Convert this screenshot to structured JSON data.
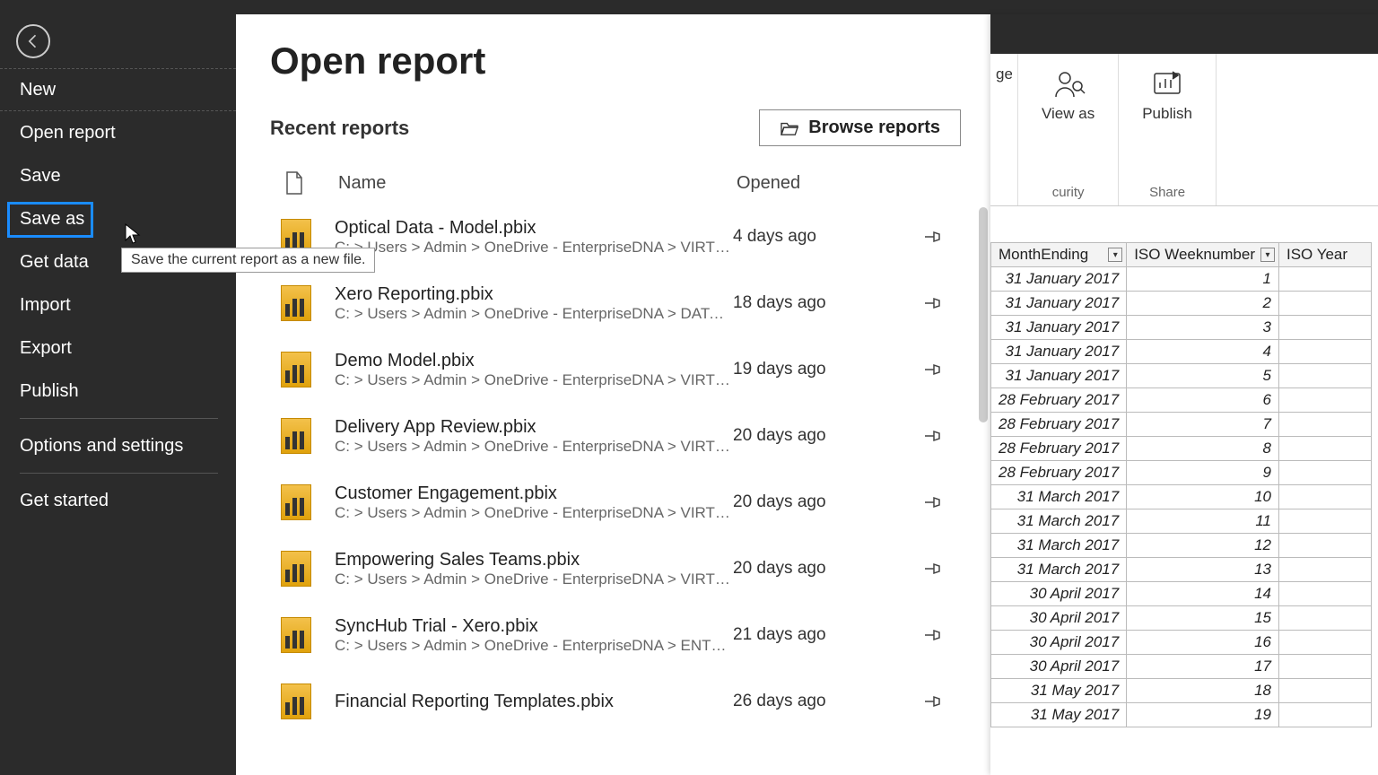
{
  "sidebar": {
    "items": [
      {
        "label": "New"
      },
      {
        "label": "Open report"
      },
      {
        "label": "Save"
      },
      {
        "label": "Save as"
      },
      {
        "label": "Get data"
      },
      {
        "label": "Import"
      },
      {
        "label": "Export"
      },
      {
        "label": "Publish"
      },
      {
        "label": "Options and settings"
      },
      {
        "label": "Get started"
      }
    ],
    "tooltip": "Save the current report as a new file."
  },
  "main": {
    "title": "Open report",
    "recent_label": "Recent reports",
    "browse_label": "Browse reports",
    "columns": {
      "name": "Name",
      "opened": "Opened"
    },
    "rows": [
      {
        "name": "Optical Data - Model.pbix",
        "path": "C: > Users > Admin > OneDrive - EnterpriseDNA > VIRTUAL...",
        "opened": "4 days ago"
      },
      {
        "name": "Xero Reporting.pbix",
        "path": "C: > Users > Admin > OneDrive - EnterpriseDNA > DATA N...",
        "opened": "18 days ago"
      },
      {
        "name": "Demo Model.pbix",
        "path": "C: > Users > Admin > OneDrive - EnterpriseDNA > VIRTUAL...",
        "opened": "19 days ago"
      },
      {
        "name": "Delivery App Review.pbix",
        "path": "C: > Users > Admin > OneDrive - EnterpriseDNA > VIRTUAL...",
        "opened": "20 days ago"
      },
      {
        "name": "Customer Engagement.pbix",
        "path": "C: > Users > Admin > OneDrive - EnterpriseDNA > VIRTUAL...",
        "opened": "20 days ago"
      },
      {
        "name": "Empowering Sales Teams.pbix",
        "path": "C: > Users > Admin > OneDrive - EnterpriseDNA > VIRTUAL...",
        "opened": "20 days ago"
      },
      {
        "name": "SyncHub Trial - Xero.pbix",
        "path": "C: > Users > Admin > OneDrive - EnterpriseDNA > ENTERP...",
        "opened": "21 days ago"
      },
      {
        "name": "Financial Reporting Templates.pbix",
        "path": "",
        "opened": "26 days ago"
      }
    ]
  },
  "ribbon": {
    "truncated_button": "ge",
    "view_as": "View as",
    "publish": "Publish",
    "group_security": "curity",
    "group_share": "Share"
  },
  "table": {
    "headers": [
      "MonthEnding",
      "ISO Weeknumber",
      "ISO Year"
    ],
    "rows": [
      [
        "31 January 2017",
        "1"
      ],
      [
        "31 January 2017",
        "2"
      ],
      [
        "31 January 2017",
        "3"
      ],
      [
        "31 January 2017",
        "4"
      ],
      [
        "31 January 2017",
        "5"
      ],
      [
        "28 February 2017",
        "6"
      ],
      [
        "28 February 2017",
        "7"
      ],
      [
        "28 February 2017",
        "8"
      ],
      [
        "28 February 2017",
        "9"
      ],
      [
        "31 March 2017",
        "10"
      ],
      [
        "31 March 2017",
        "11"
      ],
      [
        "31 March 2017",
        "12"
      ],
      [
        "31 March 2017",
        "13"
      ],
      [
        "30 April 2017",
        "14"
      ],
      [
        "30 April 2017",
        "15"
      ],
      [
        "30 April 2017",
        "16"
      ],
      [
        "30 April 2017",
        "17"
      ],
      [
        "31 May 2017",
        "18"
      ],
      [
        "31 May 2017",
        "19"
      ]
    ]
  }
}
